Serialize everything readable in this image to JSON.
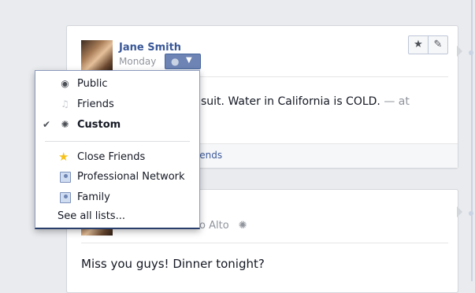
{
  "post1": {
    "author": "Jane Smith",
    "date": "Monday",
    "body_visible": "suit. Water in California is COLD.",
    "body_suffix": "— at",
    "footer_link": "riends",
    "actions": {
      "star_icon": "★",
      "edit_icon": "✎"
    },
    "audience_button": {
      "globe_icon": "●",
      "caret_icon": "▼"
    }
  },
  "post2": {
    "location": "o Alto",
    "location_icon": "✺",
    "message": "Miss you guys! Dinner tonight?"
  },
  "audience_menu": {
    "items": [
      {
        "label": "Public",
        "icon": "globe-icon",
        "glyph": "◉",
        "checked": false
      },
      {
        "label": "Friends",
        "icon": "friends-icon",
        "glyph": "♫",
        "checked": false
      },
      {
        "label": "Custom",
        "icon": "gear-icon",
        "glyph": "✺",
        "checked": true,
        "check_glyph": "✔"
      }
    ],
    "lists": [
      {
        "label": "Close Friends",
        "icon": "star-list-icon",
        "glyph": "★"
      },
      {
        "label": "Professional Network",
        "icon": "person-list-icon"
      },
      {
        "label": "Family",
        "icon": "person-list-icon"
      }
    ],
    "see_all": "See all lists..."
  },
  "colors": {
    "link": "#3b5998",
    "button": "#6d84b4",
    "muted": "#90949c"
  }
}
